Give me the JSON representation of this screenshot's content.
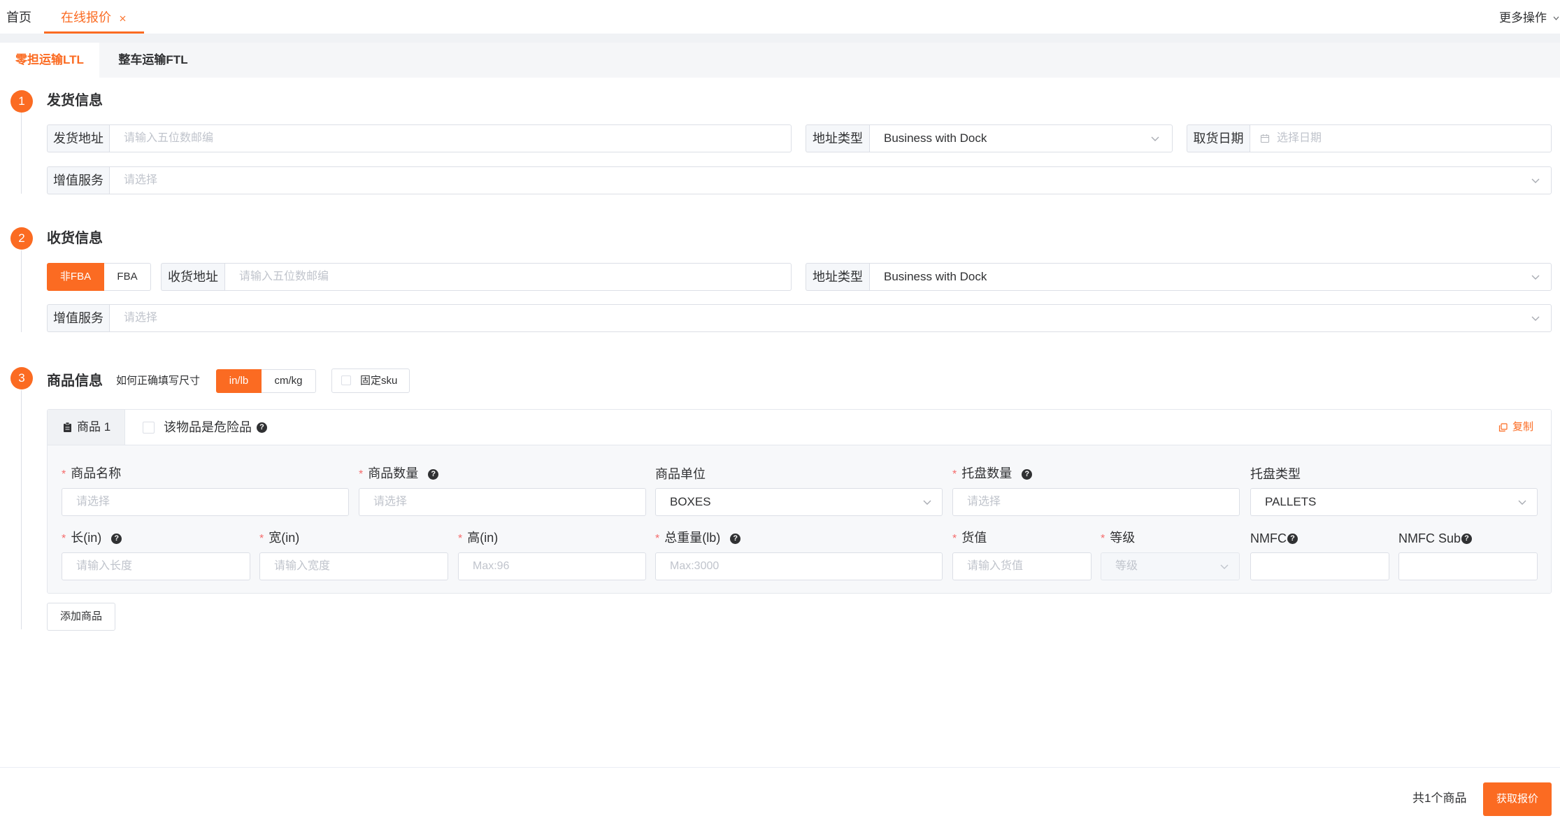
{
  "colors": {
    "accent": "#fb6b22",
    "border": "#dcdfe6",
    "label_bg": "#f5f7fa",
    "required": "#f56c6c",
    "text": "#303133",
    "placeholder": "#c0c4cc"
  },
  "icons": [
    "close-icon",
    "chevron-down-icon",
    "calendar-icon",
    "clipboard-icon",
    "copy-icon",
    "question-icon",
    "checkbox-icon"
  ],
  "top_tabs": {
    "home": "首页",
    "active": "在线报价",
    "more": "更多操作"
  },
  "mode_tabs": [
    {
      "label": "零担运输LTL",
      "active": true
    },
    {
      "label": "整车运输FTL",
      "active": false
    }
  ],
  "shipper": {
    "step": "1",
    "title": "发货信息",
    "address": {
      "label": "发货地址",
      "placeholder": "请输入五位数邮编"
    },
    "address_type": {
      "label": "地址类型",
      "value": "Business with Dock"
    },
    "pickup_date": {
      "label": "取货日期",
      "placeholder": "选择日期"
    },
    "services": {
      "label": "增值服务",
      "placeholder": "请选择"
    }
  },
  "consignee": {
    "step": "2",
    "title": "收货信息",
    "type_toggle": [
      {
        "label": "非FBA",
        "active": true
      },
      {
        "label": "FBA",
        "active": false
      }
    ],
    "address": {
      "label": "收货地址",
      "placeholder": "请输入五位数邮编"
    },
    "address_type": {
      "label": "地址类型",
      "value": "Business with Dock"
    },
    "services": {
      "label": "增值服务",
      "placeholder": "请选择"
    }
  },
  "goods": {
    "step": "3",
    "title": "商品信息",
    "size_help": "如何正确填写尺寸",
    "unit_toggle": [
      {
        "label": "in/lb",
        "active": true
      },
      {
        "label": "cm/kg",
        "active": false
      }
    ],
    "fixed_sku": {
      "label": "固定sku",
      "checked": false
    },
    "add_button": "添加商品"
  },
  "product": {
    "tab_label": "商品 1",
    "hazmat": {
      "label": "该物品是危险品",
      "checked": false
    },
    "copy": "复制",
    "fields": {
      "name": {
        "label": "商品名称",
        "required": true,
        "placeholder": "请选择"
      },
      "quantity": {
        "label": "商品数量",
        "required": true,
        "help": true,
        "placeholder": "请选择"
      },
      "unit": {
        "label": "商品单位",
        "value": "BOXES"
      },
      "pallet_count": {
        "label": "托盘数量",
        "required": true,
        "help": true,
        "placeholder": "请选择"
      },
      "pallet_type": {
        "label": "托盘类型",
        "value": "PALLETS"
      },
      "length": {
        "label": "长(in)",
        "required": true,
        "help": true,
        "placeholder": "请输入长度"
      },
      "width": {
        "label": "宽(in)",
        "required": true,
        "placeholder": "请输入宽度"
      },
      "height": {
        "label": "高(in)",
        "required": true,
        "placeholder": "Max:96"
      },
      "weight": {
        "label": "总重量(lb)",
        "required": true,
        "help": true,
        "placeholder": "Max:3000"
      },
      "goods_value": {
        "label": "货值",
        "required": true,
        "placeholder": "请输入货值"
      },
      "freight_class": {
        "label": "等级",
        "required": true,
        "placeholder": "等级"
      },
      "nmfc": {
        "label": "NMFC",
        "help": true
      },
      "nmfc_sub": {
        "label": "NMFC Sub",
        "help": true
      }
    }
  },
  "footer": {
    "count": "共1个商品",
    "submit": "获取报价"
  }
}
